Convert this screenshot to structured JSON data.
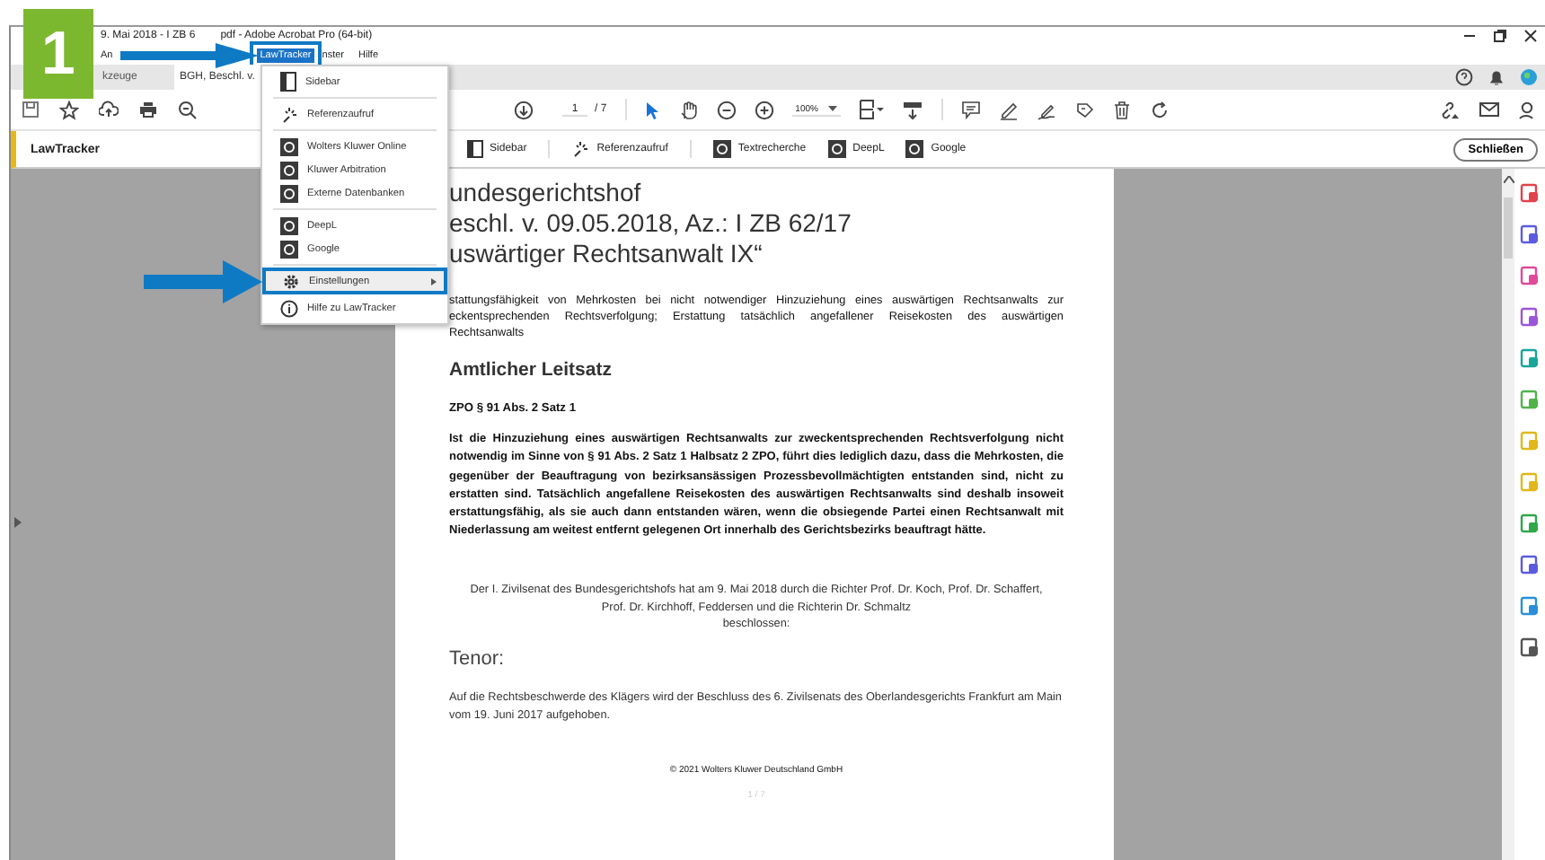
{
  "badge": "1",
  "window": {
    "title_parts": [
      "9. Mai 2018 - I ZB 6",
      "pdf - Adobe Acrobat Pro (64-bit)"
    ]
  },
  "menu_bar": [
    {
      "label": "An",
      "selected": false
    },
    {
      "label": "LawTracker",
      "selected": true
    },
    {
      "label": "nster",
      "selected": false
    },
    {
      "label": "Hilfe",
      "selected": false
    }
  ],
  "tabs": [
    {
      "label": "kzeuge",
      "selected": false
    },
    {
      "label": "BGH, Beschl. v.",
      "selected": true
    }
  ],
  "toolbar": {
    "page_number": "1",
    "page_count": "/ 7",
    "zoom": "100%"
  },
  "panel": {
    "title": "LawTracker",
    "buttons": [
      "Sidebar",
      "Referenzaufruf",
      "Textrecherche",
      "DeepL",
      "Google"
    ],
    "close": "Schließen"
  },
  "dropdown": {
    "groups": [
      [
        {
          "label": "Sidebar",
          "selected": false,
          "has_submenu": false
        }
      ],
      [
        {
          "label": "Referenzaufruf",
          "selected": false,
          "has_submenu": false
        }
      ],
      [
        {
          "label": "Wolters Kluwer Online",
          "selected": false,
          "has_submenu": false
        },
        {
          "label": "Kluwer Arbitration",
          "selected": false,
          "has_submenu": false
        },
        {
          "label": "Externe Datenbanken",
          "selected": false,
          "has_submenu": false
        }
      ],
      [
        {
          "label": "DeepL",
          "selected": false,
          "has_submenu": false
        },
        {
          "label": "Google",
          "selected": false,
          "has_submenu": false
        }
      ],
      [
        {
          "label": "Einstellungen",
          "selected": true,
          "has_submenu": true
        },
        {
          "label": "Hilfe zu LawTracker",
          "selected": false,
          "has_submenu": false
        }
      ]
    ]
  },
  "document": {
    "heading_lines": [
      "undesgerichtshof",
      "eschl. v. 09.05.2018, Az.: I ZB 62/17",
      "uswärtiger Rechtsanwalt IX“"
    ],
    "intro_lines": [
      "stattungsfähigkeit von Mehrkosten bei nicht notwendiger Hinzuziehung eines auswärtigen Rechtsanwalts zur",
      "eckentsprechenden Rechtsverfolgung; Erstattung tatsächlich angefallener Reisekosten des auswärtigen",
      "Rechtsanwalts"
    ],
    "section_heading": "Amtlicher Leitsatz",
    "norm": "ZPO § 91 Abs. 2 Satz 1",
    "leitsatz": "Ist die Hinzuziehung eines auswärtigen Rechtsanwalts zur zweckentsprechenden Rechtsverfolgung nicht notwendig im Sinne von § 91 Abs. 2 Satz 1 Halbsatz 2 ZPO, führt dies lediglich dazu, dass die Mehrkosten, die gegenüber der Beauftragung von bezirksansässigen Prozessbevollmächtigten entstanden sind, nicht zu erstatten sind. Tatsächlich angefallene Reisekosten des auswärtigen Rechtsanwalts sind deshalb insoweit erstattungsfähig, als sie auch dann entstanden wären, wenn die obsiegende Partei einen Rechtsanwalt mit Niederlassung am weitest entfernt gelegenen Ort innerhalb des Gerichtsbezirks beauftragt hätte.",
    "court_text": "Der I. Zivilsenat des Bundesgerichtshofs hat am 9. Mai 2018 durch die Richter Prof. Dr. Koch, Prof. Dr. Schaffert, Prof. Dr. Kirchhoff, Feddersen und die Richterin Dr. Schmaltz",
    "decided": "beschlossen:",
    "tenor_heading": "Tenor:",
    "tenor": "Auf die Rechtsbeschwerde des Klägers wird der Beschluss des 6. Zivilsenats des Oberlandesgerichts Frankfurt am Main vom 19. Juni 2017 aufgehoben.",
    "footer": "© 2021 Wolters Kluwer Deutschland GmbH",
    "page_label": "1 / 7"
  }
}
